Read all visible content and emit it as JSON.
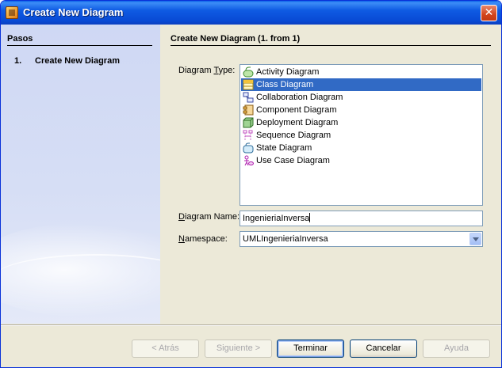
{
  "window": {
    "title": "Create New Diagram",
    "close_glyph": "✕"
  },
  "sidebar": {
    "title": "Pasos",
    "steps": [
      {
        "number": "1.",
        "label": "Create New Diagram"
      }
    ]
  },
  "panel": {
    "title": "Create New Diagram (1. from 1)",
    "diagram_type": {
      "label_pre": "Diagram ",
      "label_mnemonic": "T",
      "label_post": "ype:",
      "items": [
        {
          "label": "Activity Diagram",
          "icon": "activity-diagram-icon",
          "selected": false
        },
        {
          "label": "Class Diagram",
          "icon": "class-diagram-icon",
          "selected": true
        },
        {
          "label": "Collaboration Diagram",
          "icon": "collaboration-diagram-icon",
          "selected": false
        },
        {
          "label": "Component Diagram",
          "icon": "component-diagram-icon",
          "selected": false
        },
        {
          "label": "Deployment Diagram",
          "icon": "deployment-diagram-icon",
          "selected": false
        },
        {
          "label": "Sequence Diagram",
          "icon": "sequence-diagram-icon",
          "selected": false
        },
        {
          "label": "State Diagram",
          "icon": "state-diagram-icon",
          "selected": false
        },
        {
          "label": "Use Case Diagram",
          "icon": "use-case-diagram-icon",
          "selected": false
        }
      ]
    },
    "diagram_name": {
      "label_mnemonic": "D",
      "label_post": "iagram Name:",
      "value": "IngenieriaInversa"
    },
    "namespace": {
      "label_mnemonic": "N",
      "label_post": "amespace:",
      "value": "UMLIngenieriaInversa"
    }
  },
  "buttons": {
    "back": "< Atrás",
    "next": "Siguiente >",
    "finish": "Terminar",
    "cancel": "Cancelar",
    "help": "Ayuda"
  },
  "colors": {
    "selection": "#316ac5",
    "titlebar": "#0a5fe8"
  }
}
